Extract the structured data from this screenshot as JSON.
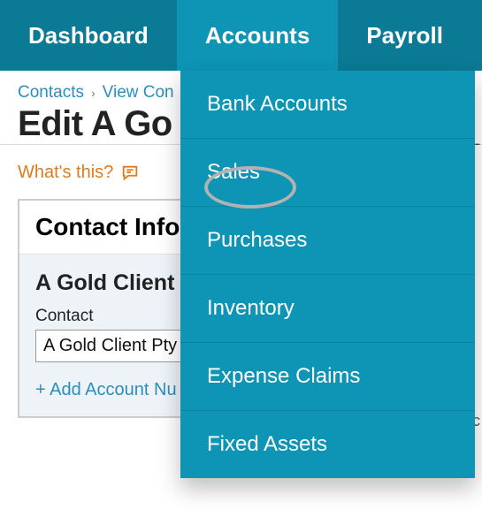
{
  "nav": {
    "dashboard": "Dashboard",
    "accounts": "Accounts",
    "payroll": "Payroll"
  },
  "dropdown": {
    "bank_accounts": "Bank Accounts",
    "sales": "Sales",
    "purchases": "Purchases",
    "inventory": "Inventory",
    "expense_claims": "Expense Claims",
    "fixed_assets": "Fixed Assets"
  },
  "breadcrumb": {
    "contacts": "Contacts",
    "view": "View Con",
    "sep": "›"
  },
  "page_title": "Edit A Go",
  "whats_this": "What's this?",
  "panel": {
    "header": "Contact Info",
    "subheading": "A Gold Client",
    "contact_label": "Contact",
    "contact_value": "A Gold Client Pty",
    "add_link": "+ Add Account Nu"
  },
  "edge_hints": {
    "l": "L",
    "c": "c"
  }
}
